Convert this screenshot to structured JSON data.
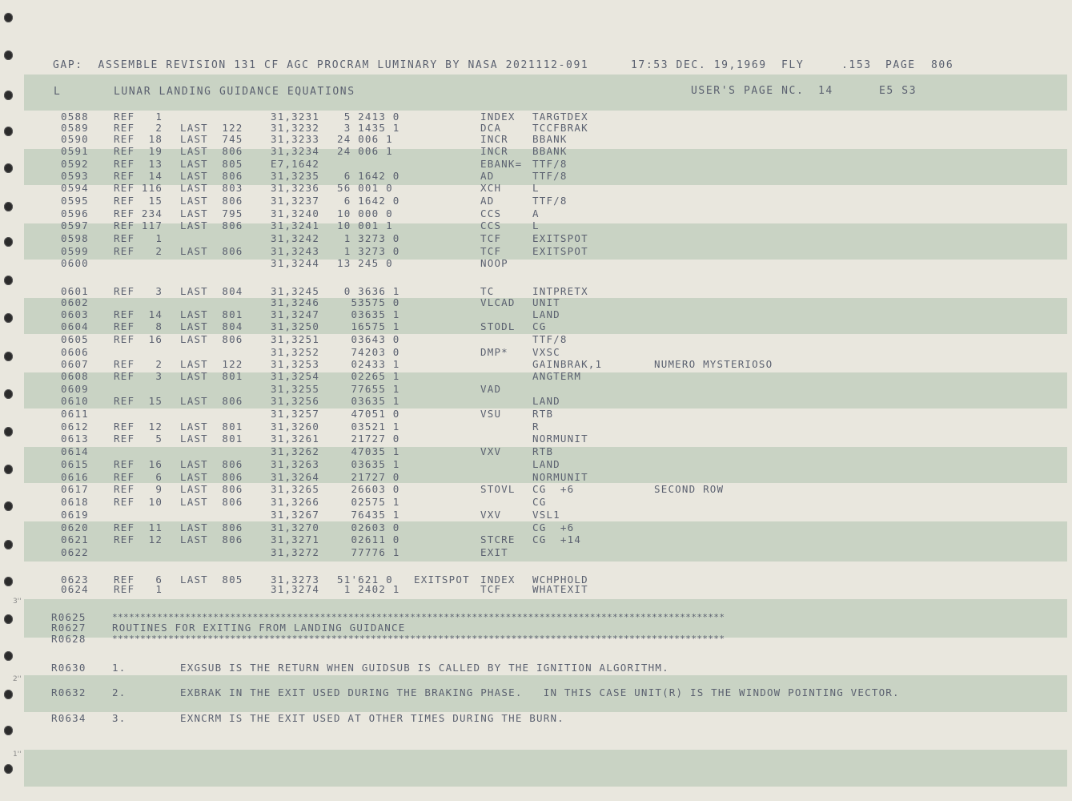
{
  "header": {
    "left": "GAP:  ASSEMBLE REVISION 131 CF AGC PROCRAM LUMINARY BY NASA 2021112-091",
    "time": "17:53 DEC. 19,1969",
    "mode": "FLY",
    "counter": ".153",
    "page_label": "PAGE",
    "page_number": "806"
  },
  "section": {
    "code": "L",
    "title": "LUNAR LANDING GUIDANCE EQUATIONS",
    "user_page": "USER'S PAGE NC.",
    "user_page_number": "14",
    "ref": "E5 S3"
  },
  "margin_marks": [
    "3''",
    "2''",
    "1''"
  ],
  "rows": [
    {
      "line": "0588",
      "ref": "REF   1",
      "last": "",
      "addr": "31,3231",
      "word": " 5 2413 0",
      "label": "",
      "op": "INDEX",
      "operand": "TARGTDEX",
      "comment": ""
    },
    {
      "line": "0589",
      "ref": "REF   2",
      "last": "LAST  122",
      "addr": "31,3232",
      "word": " 3 1435 1",
      "label": "",
      "op": "DCA",
      "operand": "TCCFBRAK",
      "comment": ""
    },
    {
      "line": "0590",
      "ref": "REF  18",
      "last": "LAST  745",
      "addr": "31,3233",
      "word": "24 006 1",
      "label": "",
      "op": "INCR",
      "operand": "BBANK",
      "comment": ""
    },
    {
      "line": "0591",
      "ref": "REF  19",
      "last": "LAST  806",
      "addr": "31,3234",
      "word": "24 006 1",
      "label": "",
      "op": "INCR",
      "operand": "BBANK",
      "comment": ""
    },
    {
      "line": "0592",
      "ref": "REF  13",
      "last": "LAST  805",
      "addr": "E7,1642",
      "word": "",
      "label": "",
      "op": "EBANK=",
      "operand": "TTF/8",
      "comment": ""
    },
    {
      "line": "0593",
      "ref": "REF  14",
      "last": "LAST  806",
      "addr": "31,3235",
      "word": " 6 1642 0",
      "label": "",
      "op": "AD",
      "operand": "TTF/8",
      "comment": ""
    },
    {
      "line": "0594",
      "ref": "REF 116",
      "last": "LAST  803",
      "addr": "31,3236",
      "word": "56 001 0",
      "label": "",
      "op": "XCH",
      "operand": "L",
      "comment": ""
    },
    {
      "line": "0595",
      "ref": "REF  15",
      "last": "LAST  806",
      "addr": "31,3237",
      "word": " 6 1642 0",
      "label": "",
      "op": "AD",
      "operand": "TTF/8",
      "comment": ""
    },
    {
      "line": "0596",
      "ref": "REF 234",
      "last": "LAST  795",
      "addr": "31,3240",
      "word": "10 000 0",
      "label": "",
      "op": "CCS",
      "operand": "A",
      "comment": ""
    },
    {
      "line": "0597",
      "ref": "REF 117",
      "last": "LAST  806",
      "addr": "31,3241",
      "word": "10 001 1",
      "label": "",
      "op": "CCS",
      "operand": "L",
      "comment": ""
    },
    {
      "line": "0598",
      "ref": "REF   1",
      "last": "",
      "addr": "31,3242",
      "word": " 1 3273 0",
      "label": "",
      "op": "TCF",
      "operand": "EXITSPOT",
      "comment": ""
    },
    {
      "line": "0599",
      "ref": "REF   2",
      "last": "LAST  806",
      "addr": "31,3243",
      "word": " 1 3273 0",
      "label": "",
      "op": "TCF",
      "operand": "EXITSPOT",
      "comment": ""
    },
    {
      "line": "0600",
      "ref": "",
      "last": "",
      "addr": "31,3244",
      "word": "13 245 0",
      "label": "",
      "op": "NOOP",
      "operand": "",
      "comment": ""
    },
    {
      "line": "0601",
      "ref": "REF   3",
      "last": "LAST  804",
      "addr": "31,3245",
      "word": " 0 3636 1",
      "label": "",
      "op": "TC",
      "operand": "INTPRETX",
      "comment": ""
    },
    {
      "line": "0602",
      "ref": "",
      "last": "",
      "addr": "31,3246",
      "word": "  53575 0",
      "label": "",
      "op": "VLCAD",
      "operand": "UNIT",
      "comment": ""
    },
    {
      "line": "0603",
      "ref": "REF  14",
      "last": "LAST  801",
      "addr": "31,3247",
      "word": "  03635 1",
      "label": "",
      "op": "",
      "operand": "LAND",
      "comment": ""
    },
    {
      "line": "0604",
      "ref": "REF   8",
      "last": "LAST  804",
      "addr": "31,3250",
      "word": "  16575 1",
      "label": "",
      "op": "STODL",
      "operand": "CG",
      "comment": ""
    },
    {
      "line": "0605",
      "ref": "REF  16",
      "last": "LAST  806",
      "addr": "31,3251",
      "word": "  03643 0",
      "label": "",
      "op": "",
      "operand": "TTF/8",
      "comment": ""
    },
    {
      "line": "0606",
      "ref": "",
      "last": "",
      "addr": "31,3252",
      "word": "  74203 0",
      "label": "",
      "op": "DMP*",
      "operand": "VXSC",
      "comment": ""
    },
    {
      "line": "0607",
      "ref": "REF   2",
      "last": "LAST  122",
      "addr": "31,3253",
      "word": "  02433 1",
      "label": "",
      "op": "",
      "operand": "GAINBRAK,1",
      "comment": "NUMERO MYSTERIOSO"
    },
    {
      "line": "0608",
      "ref": "REF   3",
      "last": "LAST  801",
      "addr": "31,3254",
      "word": "  02265 1",
      "label": "",
      "op": "",
      "operand": "ANGTERM",
      "comment": ""
    },
    {
      "line": "0609",
      "ref": "",
      "last": "",
      "addr": "31,3255",
      "word": "  77655 1",
      "label": "",
      "op": "VAD",
      "operand": "",
      "comment": ""
    },
    {
      "line": "0610",
      "ref": "REF  15",
      "last": "LAST  806",
      "addr": "31,3256",
      "word": "  03635 1",
      "label": "",
      "op": "",
      "operand": "LAND",
      "comment": ""
    },
    {
      "line": "0611",
      "ref": "",
      "last": "",
      "addr": "31,3257",
      "word": "  47051 0",
      "label": "",
      "op": "VSU",
      "operand": "RTB",
      "comment": ""
    },
    {
      "line": "0612",
      "ref": "REF  12",
      "last": "LAST  801",
      "addr": "31,3260",
      "word": "  03521 1",
      "label": "",
      "op": "",
      "operand": "R",
      "comment": ""
    },
    {
      "line": "0613",
      "ref": "REF   5",
      "last": "LAST  801",
      "addr": "31,3261",
      "word": "  21727 0",
      "label": "",
      "op": "",
      "operand": "NORMUNIT",
      "comment": ""
    },
    {
      "line": "0614",
      "ref": "",
      "last": "",
      "addr": "31,3262",
      "word": "  47035 1",
      "label": "",
      "op": "VXV",
      "operand": "RTB",
      "comment": ""
    },
    {
      "line": "0615",
      "ref": "REF  16",
      "last": "LAST  806",
      "addr": "31,3263",
      "word": "  03635 1",
      "label": "",
      "op": "",
      "operand": "LAND",
      "comment": ""
    },
    {
      "line": "0616",
      "ref": "REF   6",
      "last": "LAST  806",
      "addr": "31,3264",
      "word": "  21727 0",
      "label": "",
      "op": "",
      "operand": "NORMUNIT",
      "comment": ""
    },
    {
      "line": "0617",
      "ref": "REF   9",
      "last": "LAST  806",
      "addr": "31,3265",
      "word": "  26603 0",
      "label": "",
      "op": "STOVL",
      "operand": "CG  +6",
      "comment": "SECOND ROW"
    },
    {
      "line": "0618",
      "ref": "REF  10",
      "last": "LAST  806",
      "addr": "31,3266",
      "word": "  02575 1",
      "label": "",
      "op": "",
      "operand": "CG",
      "comment": ""
    },
    {
      "line": "0619",
      "ref": "",
      "last": "",
      "addr": "31,3267",
      "word": "  76435 1",
      "label": "",
      "op": "VXV",
      "operand": "VSL1",
      "comment": ""
    },
    {
      "line": "0620",
      "ref": "REF  11",
      "last": "LAST  806",
      "addr": "31,3270",
      "word": "  02603 0",
      "label": "",
      "op": "",
      "operand": "CG  +6",
      "comment": ""
    },
    {
      "line": "0621",
      "ref": "REF  12",
      "last": "LAST  806",
      "addr": "31,3271",
      "word": "  02611 0",
      "label": "",
      "op": "STCRE",
      "operand": "CG  +14",
      "comment": ""
    },
    {
      "line": "0622",
      "ref": "",
      "last": "",
      "addr": "31,3272",
      "word": "  77776 1",
      "label": "",
      "op": "EXIT",
      "operand": "",
      "comment": ""
    },
    {
      "line": "0623",
      "ref": "REF   6",
      "last": "LAST  805",
      "addr": "31,3273",
      "word": "51'621 0",
      "label": "EXITSPOT",
      "op": "INDEX",
      "operand": "WCHPHOLD",
      "comment": ""
    },
    {
      "line": "0624",
      "ref": "REF   1",
      "last": "",
      "addr": "31,3274",
      "word": " 1 2402 1",
      "label": "",
      "op": "TCF",
      "operand": "WHATEXIT",
      "comment": ""
    }
  ],
  "routine_block": {
    "r0625_line": "R0625",
    "r0625_text": "*************************************************************************************************************",
    "r0627_line": "R0627",
    "r0627_text": "ROUTINES FOR EXITING FROM LANDING GUIDANCE",
    "r0628_line": "R0628",
    "r0628_text": "*************************************************************************************************************"
  },
  "notes": [
    {
      "line": "R0630",
      "num": "1.",
      "text": "EXGSUB IS THE RETURN WHEN GUIDSUB IS CALLED BY THE IGNITION ALGORITHM."
    },
    {
      "line": "R0632",
      "num": "2.",
      "text": "EXBRAK IN THE EXIT USED DURING THE BRAKING PHASE.   IN THIS CASE UNIT(R) IS THE WINDOW POINTING VECTOR."
    },
    {
      "line": "R0634",
      "num": "3.",
      "text": "EXNCRM IS THE EXIT USED AT OTHER TIMES DURING THE BURN."
    }
  ]
}
